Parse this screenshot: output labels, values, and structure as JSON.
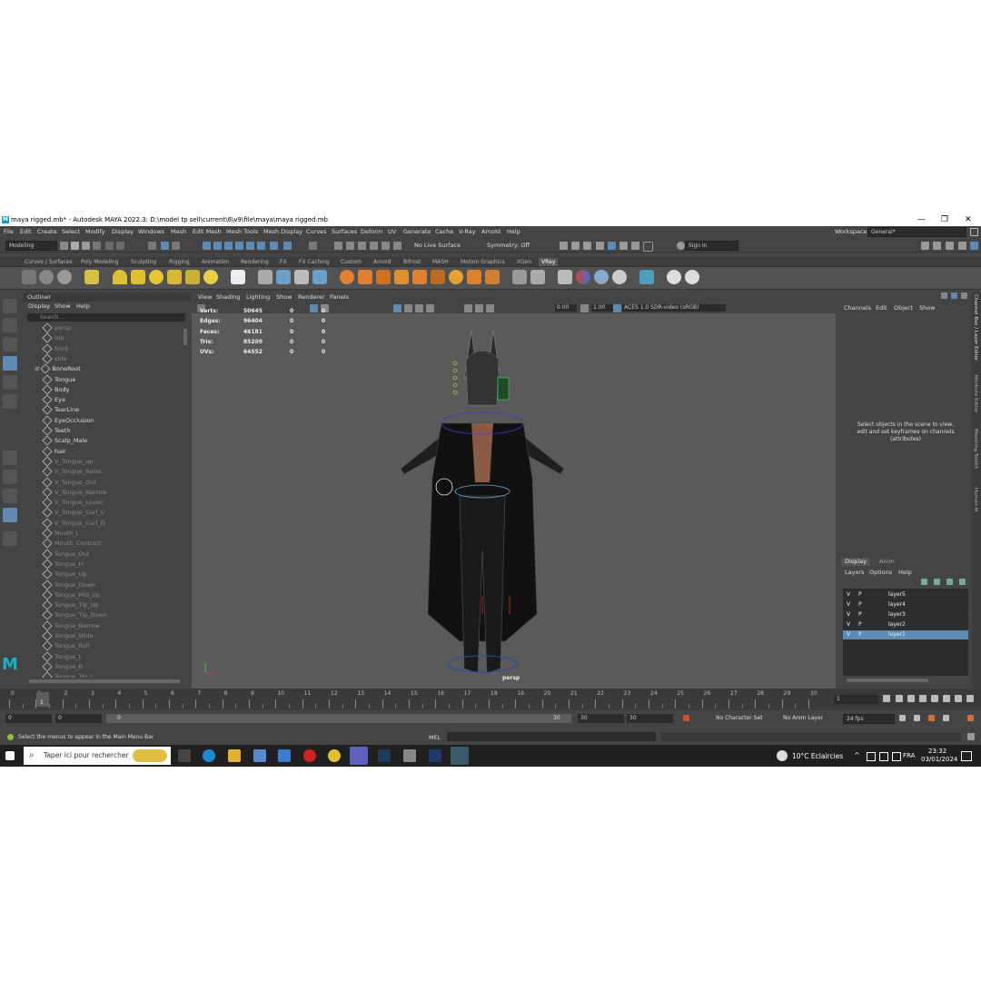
{
  "window": {
    "title": "maya rigged.mb* - Autodesk MAYA 2022.3: D:\\model tp sell\\current\\6\\v9\\file\\maya\\maya rigged.mb",
    "controls": [
      "—",
      "❐",
      "✕"
    ]
  },
  "menubar": {
    "items": [
      "File",
      "Edit",
      "Create",
      "Select",
      "Modify",
      "Display",
      "Windows",
      "Mesh",
      "Edit Mesh",
      "Mesh Tools",
      "Mesh Display",
      "Curves",
      "Surfaces",
      "Deform",
      "UV",
      "Generate",
      "Cache",
      "V-Ray",
      "Arnold",
      "Help"
    ],
    "workspace_label": "Workspace:",
    "workspace_value": "General*"
  },
  "statusline": {
    "mode": "Modeling",
    "live_surface": "No Live Surface",
    "symmetry": "Symmetry: Off",
    "sign_in": "Sign In"
  },
  "shelf": {
    "tabs": [
      "Curves / Surfaces",
      "Poly Modeling",
      "Sculpting",
      "Rigging",
      "Animation",
      "Rendering",
      "FX",
      "FX Caching",
      "Custom",
      "Arnold",
      "Bifrost",
      "MASH",
      "Motion Graphics",
      "XGen",
      "VRay"
    ],
    "active_tab": "VRay"
  },
  "outliner": {
    "title": "Outliner",
    "menu": [
      "Display",
      "Show",
      "Help"
    ],
    "search_placeholder": "Search...",
    "items": [
      {
        "name": "persp",
        "dim": true
      },
      {
        "name": "top",
        "dim": true
      },
      {
        "name": "front",
        "dim": true
      },
      {
        "name": "side",
        "dim": true
      },
      {
        "name": "BoneRoot",
        "dim": false
      },
      {
        "name": "Tongue",
        "dim": false
      },
      {
        "name": "Body",
        "dim": false
      },
      {
        "name": "Eye",
        "dim": false
      },
      {
        "name": "TearLine",
        "dim": false
      },
      {
        "name": "EyeOcclusion",
        "dim": false
      },
      {
        "name": "Teeth",
        "dim": false
      },
      {
        "name": "Scalp_Male",
        "dim": false
      },
      {
        "name": "hair",
        "dim": false
      },
      {
        "name": "V_Tongue_up",
        "dim": true
      },
      {
        "name": "V_Tongue_Raise",
        "dim": true
      },
      {
        "name": "V_Tongue_Out",
        "dim": true
      },
      {
        "name": "V_Tongue_Narrow",
        "dim": true
      },
      {
        "name": "V_Tongue_Lower",
        "dim": true
      },
      {
        "name": "V_Tongue_Curl_U",
        "dim": true
      },
      {
        "name": "V_Tongue_Curl_D",
        "dim": true
      },
      {
        "name": "Mouth_L",
        "dim": true
      },
      {
        "name": "Mouth_Contract",
        "dim": true
      },
      {
        "name": "Tongue_Out",
        "dim": true
      },
      {
        "name": "Tongue_In",
        "dim": true
      },
      {
        "name": "Tongue_Up",
        "dim": true
      },
      {
        "name": "Tongue_Down",
        "dim": true
      },
      {
        "name": "Tongue_Mid_Up",
        "dim": true
      },
      {
        "name": "Tongue_Tip_Up",
        "dim": true
      },
      {
        "name": "Tongue_Tip_Down",
        "dim": true
      },
      {
        "name": "Tongue_Narrow",
        "dim": true
      },
      {
        "name": "Tongue_Wide",
        "dim": true
      },
      {
        "name": "Tongue_Roll",
        "dim": true
      },
      {
        "name": "Tongue_L",
        "dim": true
      },
      {
        "name": "Tongue_R",
        "dim": true
      },
      {
        "name": "Tongue_Tip_L",
        "dim": true
      }
    ]
  },
  "viewport": {
    "menu": [
      "View",
      "Shading",
      "Lighting",
      "Show",
      "Renderer",
      "Panels"
    ],
    "near_value": "0.00",
    "far_value": "1.00",
    "color_space": "ACES 1.0 SDR-video (sRGB)",
    "camera_label": "persp",
    "hud": [
      {
        "label": "Verts:",
        "values": [
          "50645",
          "0",
          "0"
        ]
      },
      {
        "label": "Edges:",
        "values": [
          "96404",
          "0",
          "0"
        ]
      },
      {
        "label": "Faces:",
        "values": [
          "46181",
          "0",
          "0"
        ]
      },
      {
        "label": "Tris:",
        "values": [
          "85209",
          "0",
          "0"
        ]
      },
      {
        "label": "UVs:",
        "values": [
          "64552",
          "0",
          "0"
        ]
      }
    ]
  },
  "channelbox": {
    "menu": [
      "Channels",
      "Edit",
      "Object",
      "Show"
    ],
    "hint": "Select objects in the scene to view, edit and set keyframes on channels (attributes)"
  },
  "sidetabs": [
    "Channel Box / Layer Editor",
    "Attribute Editor",
    "Modeling Toolkit",
    "Human IK"
  ],
  "layereditor": {
    "tabs": [
      "Display",
      "Anim"
    ],
    "active_tab": "Display",
    "menu": [
      "Layers",
      "Options",
      "Help"
    ],
    "layers": [
      {
        "v": "V",
        "p": "P",
        "name": "layer5",
        "selected": false
      },
      {
        "v": "V",
        "p": "P",
        "name": "layer4",
        "selected": false
      },
      {
        "v": "V",
        "p": "P",
        "name": "layer3",
        "selected": false
      },
      {
        "v": "V",
        "p": "P",
        "name": "layer2",
        "selected": false
      },
      {
        "v": "V",
        "p": "P",
        "name": "layer1",
        "selected": true
      }
    ]
  },
  "timeslider": {
    "ticks": [
      "0",
      "1",
      "2",
      "3",
      "4",
      "5",
      "6",
      "7",
      "8",
      "9",
      "10",
      "11",
      "12",
      "13",
      "14",
      "15",
      "16",
      "17",
      "18",
      "19",
      "20",
      "21",
      "22",
      "23",
      "24",
      "25",
      "26",
      "27",
      "28",
      "29",
      "30"
    ],
    "current_frame_marker": "1",
    "current_frame": "1"
  },
  "rangeslider": {
    "start": "0",
    "anim_start": "0",
    "range_start_label": "0",
    "range_end_label": "30",
    "range_end": "30",
    "anim_end": "30",
    "character_set": "No Character Set",
    "anim_layer": "No Anim Layer",
    "fps": "24 fps"
  },
  "helpline": {
    "text": "Select the menus to appear in the Main Menu Bar",
    "mel_label": "MEL"
  },
  "taskbar": {
    "search_placeholder": "Taper ici pour rechercher",
    "weather": "10°C  Eclaircies",
    "lang": "FRA",
    "time": "23:32",
    "date": "03/01/2024"
  }
}
